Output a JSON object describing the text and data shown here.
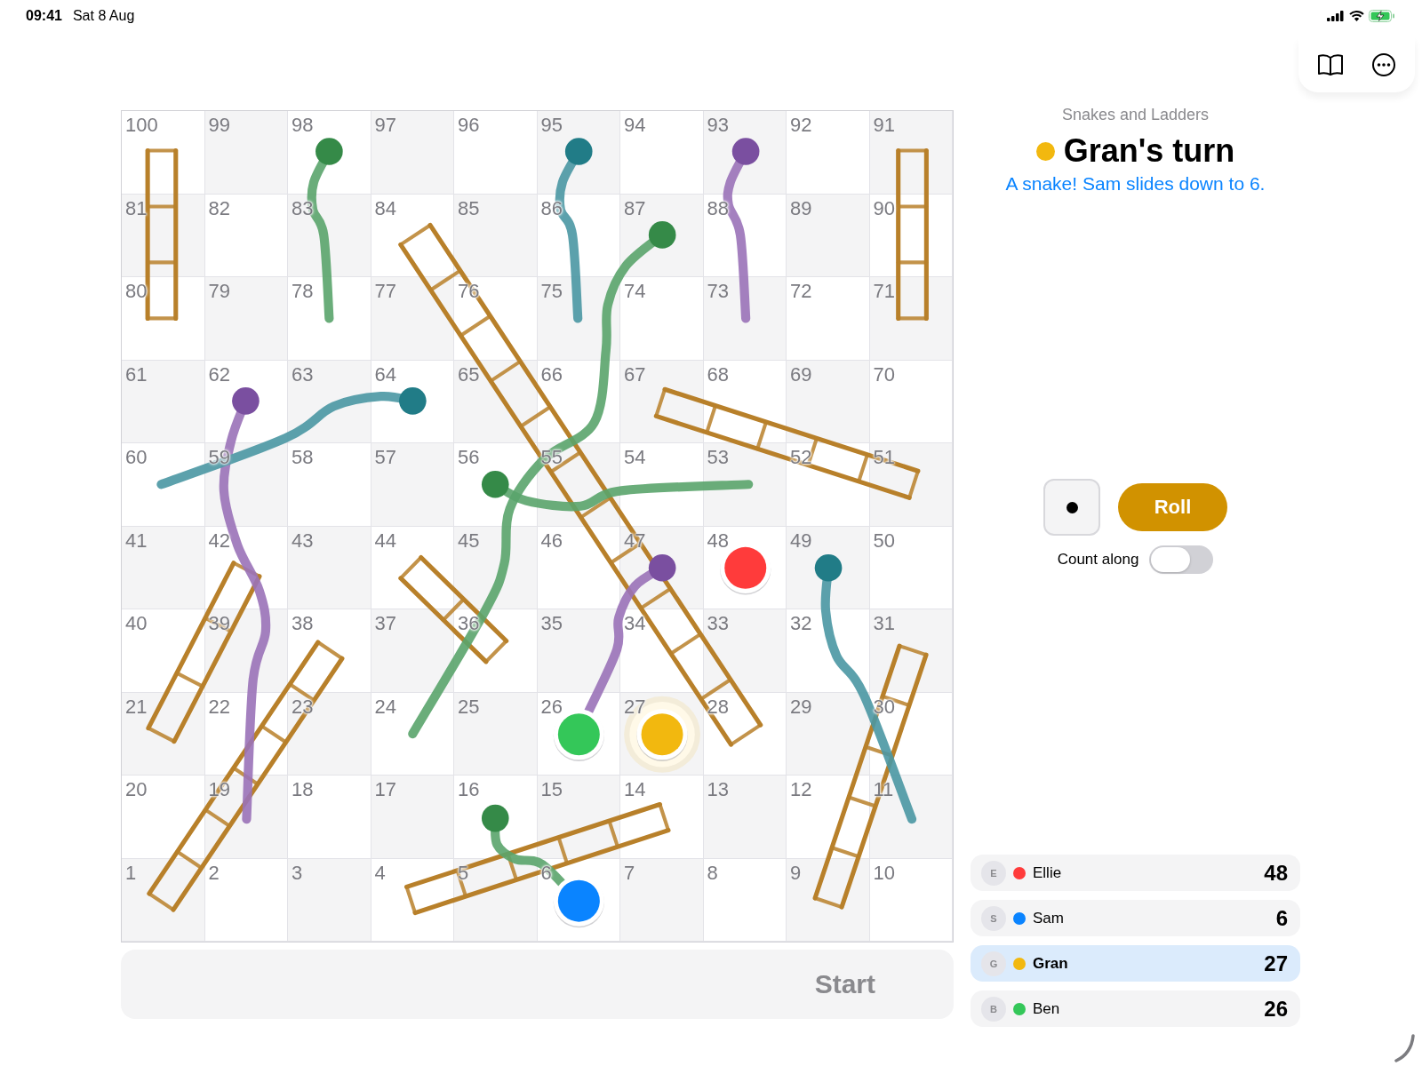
{
  "status_bar": {
    "time": "09:41",
    "date": "Sat 8 Aug"
  },
  "toolbar": {
    "buttons": [
      {
        "kind": "book"
      },
      {
        "kind": "more"
      }
    ]
  },
  "board": {
    "rows": [
      [
        "100",
        "99",
        "98",
        "97",
        "96",
        "95",
        "94",
        "93",
        "92",
        "91"
      ],
      [
        "81",
        "82",
        "83",
        "84",
        "85",
        "86",
        "87",
        "88",
        "89",
        "90"
      ],
      [
        "80",
        "79",
        "78",
        "77",
        "76",
        "75",
        "74",
        "73",
        "72",
        "71"
      ],
      [
        "61",
        "62",
        "63",
        "64",
        "65",
        "66",
        "67",
        "68",
        "69",
        "70"
      ],
      [
        "60",
        "59",
        "58",
        "57",
        "56",
        "55",
        "54",
        "53",
        "52",
        "51"
      ],
      [
        "41",
        "42",
        "43",
        "44",
        "45",
        "46",
        "47",
        "48",
        "49",
        "50"
      ],
      [
        "40",
        "39",
        "38",
        "37",
        "36",
        "35",
        "34",
        "33",
        "32",
        "31"
      ],
      [
        "21",
        "22",
        "23",
        "24",
        "25",
        "26",
        "27",
        "28",
        "29",
        "30"
      ],
      [
        "20",
        "19",
        "18",
        "17",
        "16",
        "15",
        "14",
        "13",
        "12",
        "11"
      ],
      [
        "1",
        "2",
        "3",
        "4",
        "5",
        "6",
        "7",
        "8",
        "9",
        "10"
      ]
    ]
  },
  "start_label": "Start",
  "game_title": "Snakes and Ladders",
  "turn": {
    "title": "Gran's turn",
    "color": "#f2b80f"
  },
  "message": "A snake! Sam slides down to 6.",
  "roll_button": "Roll",
  "count_along": {
    "label": "Count along",
    "on": false
  },
  "players": [
    {
      "initial": "E",
      "name": "Ellie",
      "color": "#ff3b3b",
      "score": "48",
      "selected": false
    },
    {
      "initial": "S",
      "name": "Sam",
      "color": "#0a84ff",
      "score": "6",
      "selected": false
    },
    {
      "initial": "G",
      "name": "Gran",
      "color": "#f2b80f",
      "score": "27",
      "selected": true
    },
    {
      "initial": "B",
      "name": "Ben",
      "color": "#34c759",
      "score": "26",
      "selected": false
    }
  ]
}
